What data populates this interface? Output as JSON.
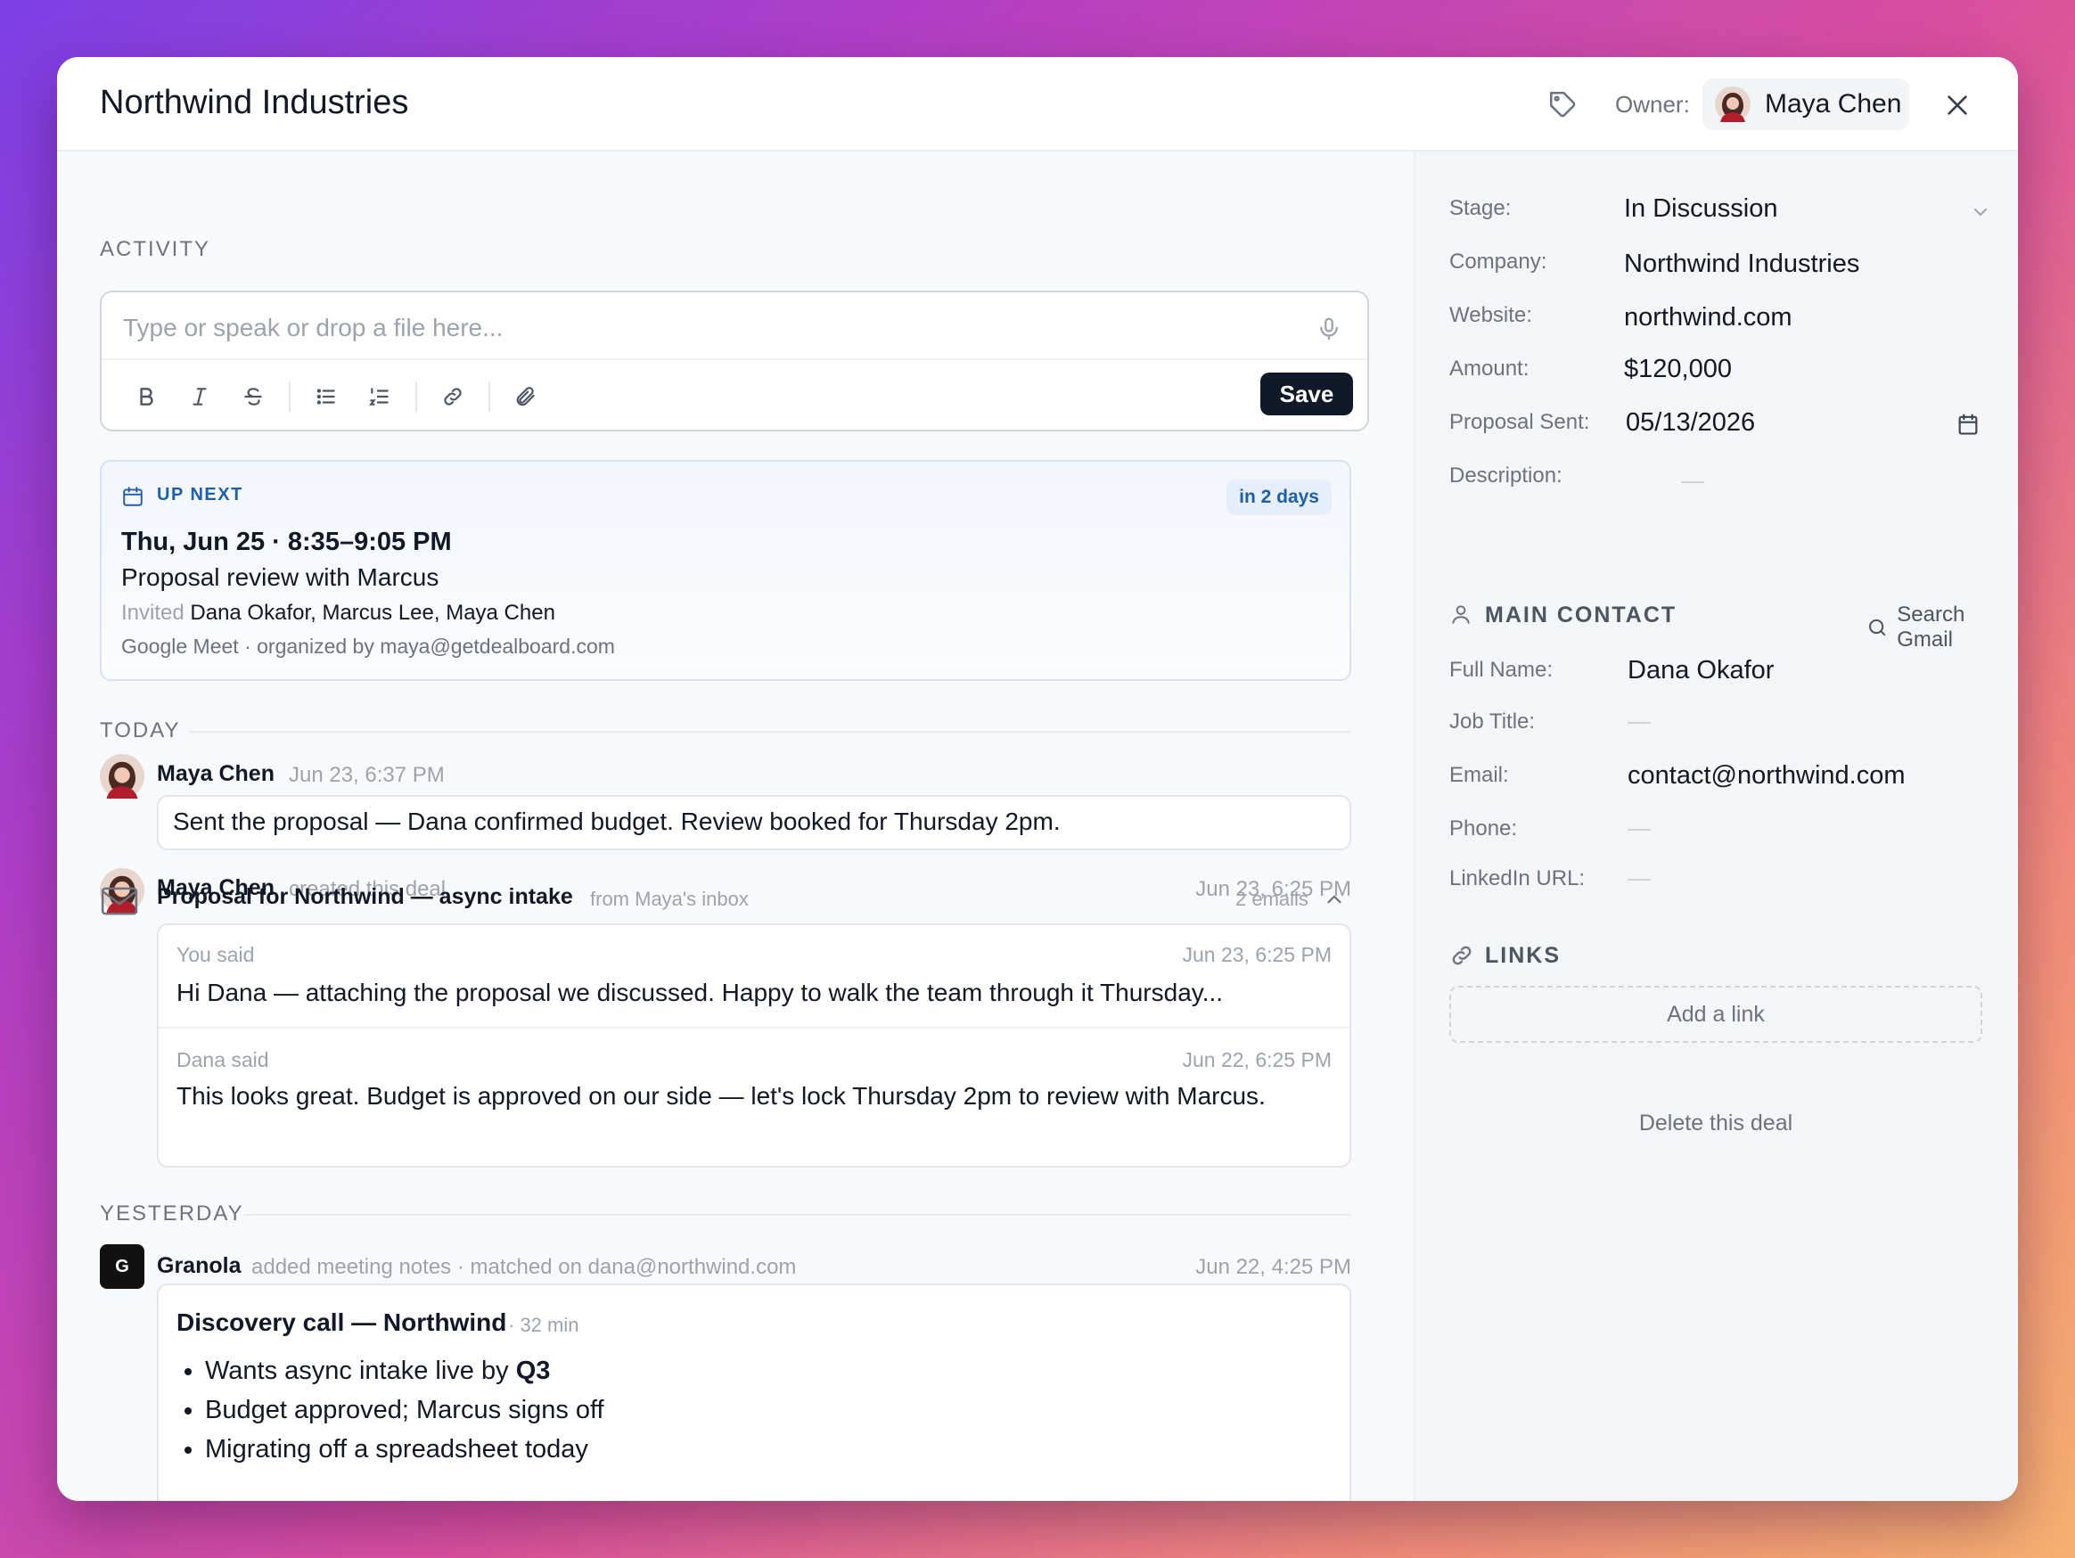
{
  "header": {
    "title": "Northwind Industries",
    "owner_label": "Owner:",
    "owner_name": "Maya Chen"
  },
  "activity": {
    "section_label": "ACTIVITY",
    "composer": {
      "placeholder": "Type or speak or drop a file here...",
      "save_label": "Save"
    },
    "up_next": {
      "label": "UP NEXT",
      "badge": "in 2 days",
      "when": "Thu, Jun 25 · 8:35–9:05 PM",
      "title": "Proposal review with Marcus",
      "invited_label": "Invited",
      "invitees": "Dana Okafor, Marcus Lee, Maya Chen",
      "meeting_info": "Google Meet · organized by maya@getdealboard.com"
    },
    "today_label": "TODAY",
    "note": {
      "author": "Maya Chen",
      "time": "Jun 23, 6:37 PM",
      "text": "Sent the proposal — Dana confirmed budget. Review booked for Thursday 2pm."
    },
    "created": {
      "author": "Maya Chen",
      "action": "created this deal",
      "time": "Jun 23, 6:25 PM"
    },
    "thread": {
      "title": "Proposal for Northwind — async intake",
      "from": "from Maya's inbox",
      "count": "2 emails",
      "messages": [
        {
          "who": "You said",
          "time": "Jun 23, 6:25 PM",
          "text": "Hi Dana — attaching the proposal we discussed. Happy to walk the team through it Thursday..."
        },
        {
          "who": "Dana said",
          "time": "Jun 22, 6:25 PM",
          "text": "This looks great. Budget is approved on our side — let's lock Thursday 2pm to review with Marcus."
        }
      ]
    },
    "yesterday_label": "YESTERDAY",
    "granola": {
      "logo": "G",
      "author": "Granola",
      "action": "added meeting notes · matched on dana@northwind.com",
      "time": "Jun 22, 4:25 PM",
      "notes_title": "Discovery call — Northwind",
      "duration": "· 32 min",
      "bullets": [
        {
          "text": "Wants async intake live by ",
          "bold": "Q3"
        },
        {
          "text": "Budget approved; Marcus signs off",
          "bold": ""
        },
        {
          "text": "Migrating off a spreadsheet today",
          "bold": ""
        }
      ]
    }
  },
  "details": {
    "stage_label": "Stage:",
    "stage_value": "In Discussion",
    "company_label": "Company:",
    "company_value": "Northwind Industries",
    "website_label": "Website:",
    "website_value": "northwind.com",
    "amount_label": "Amount:",
    "amount_value": "$120,000",
    "proposal_label": "Proposal Sent:",
    "proposal_value": "05/13/2026",
    "description_label": "Description:",
    "description_value": "—"
  },
  "contact": {
    "heading": "MAIN CONTACT",
    "search_gmail": "Search Gmail",
    "full_name_label": "Full Name:",
    "full_name_value": "Dana Okafor",
    "job_title_label": "Job Title:",
    "job_title_value": "—",
    "email_label": "Email:",
    "email_value": "contact@northwind.com",
    "phone_label": "Phone:",
    "phone_value": "—",
    "linkedin_label": "LinkedIn URL:",
    "linkedin_value": "—"
  },
  "links": {
    "heading": "LINKS",
    "add_link": "Add a link",
    "delete_deal": "Delete this deal"
  }
}
